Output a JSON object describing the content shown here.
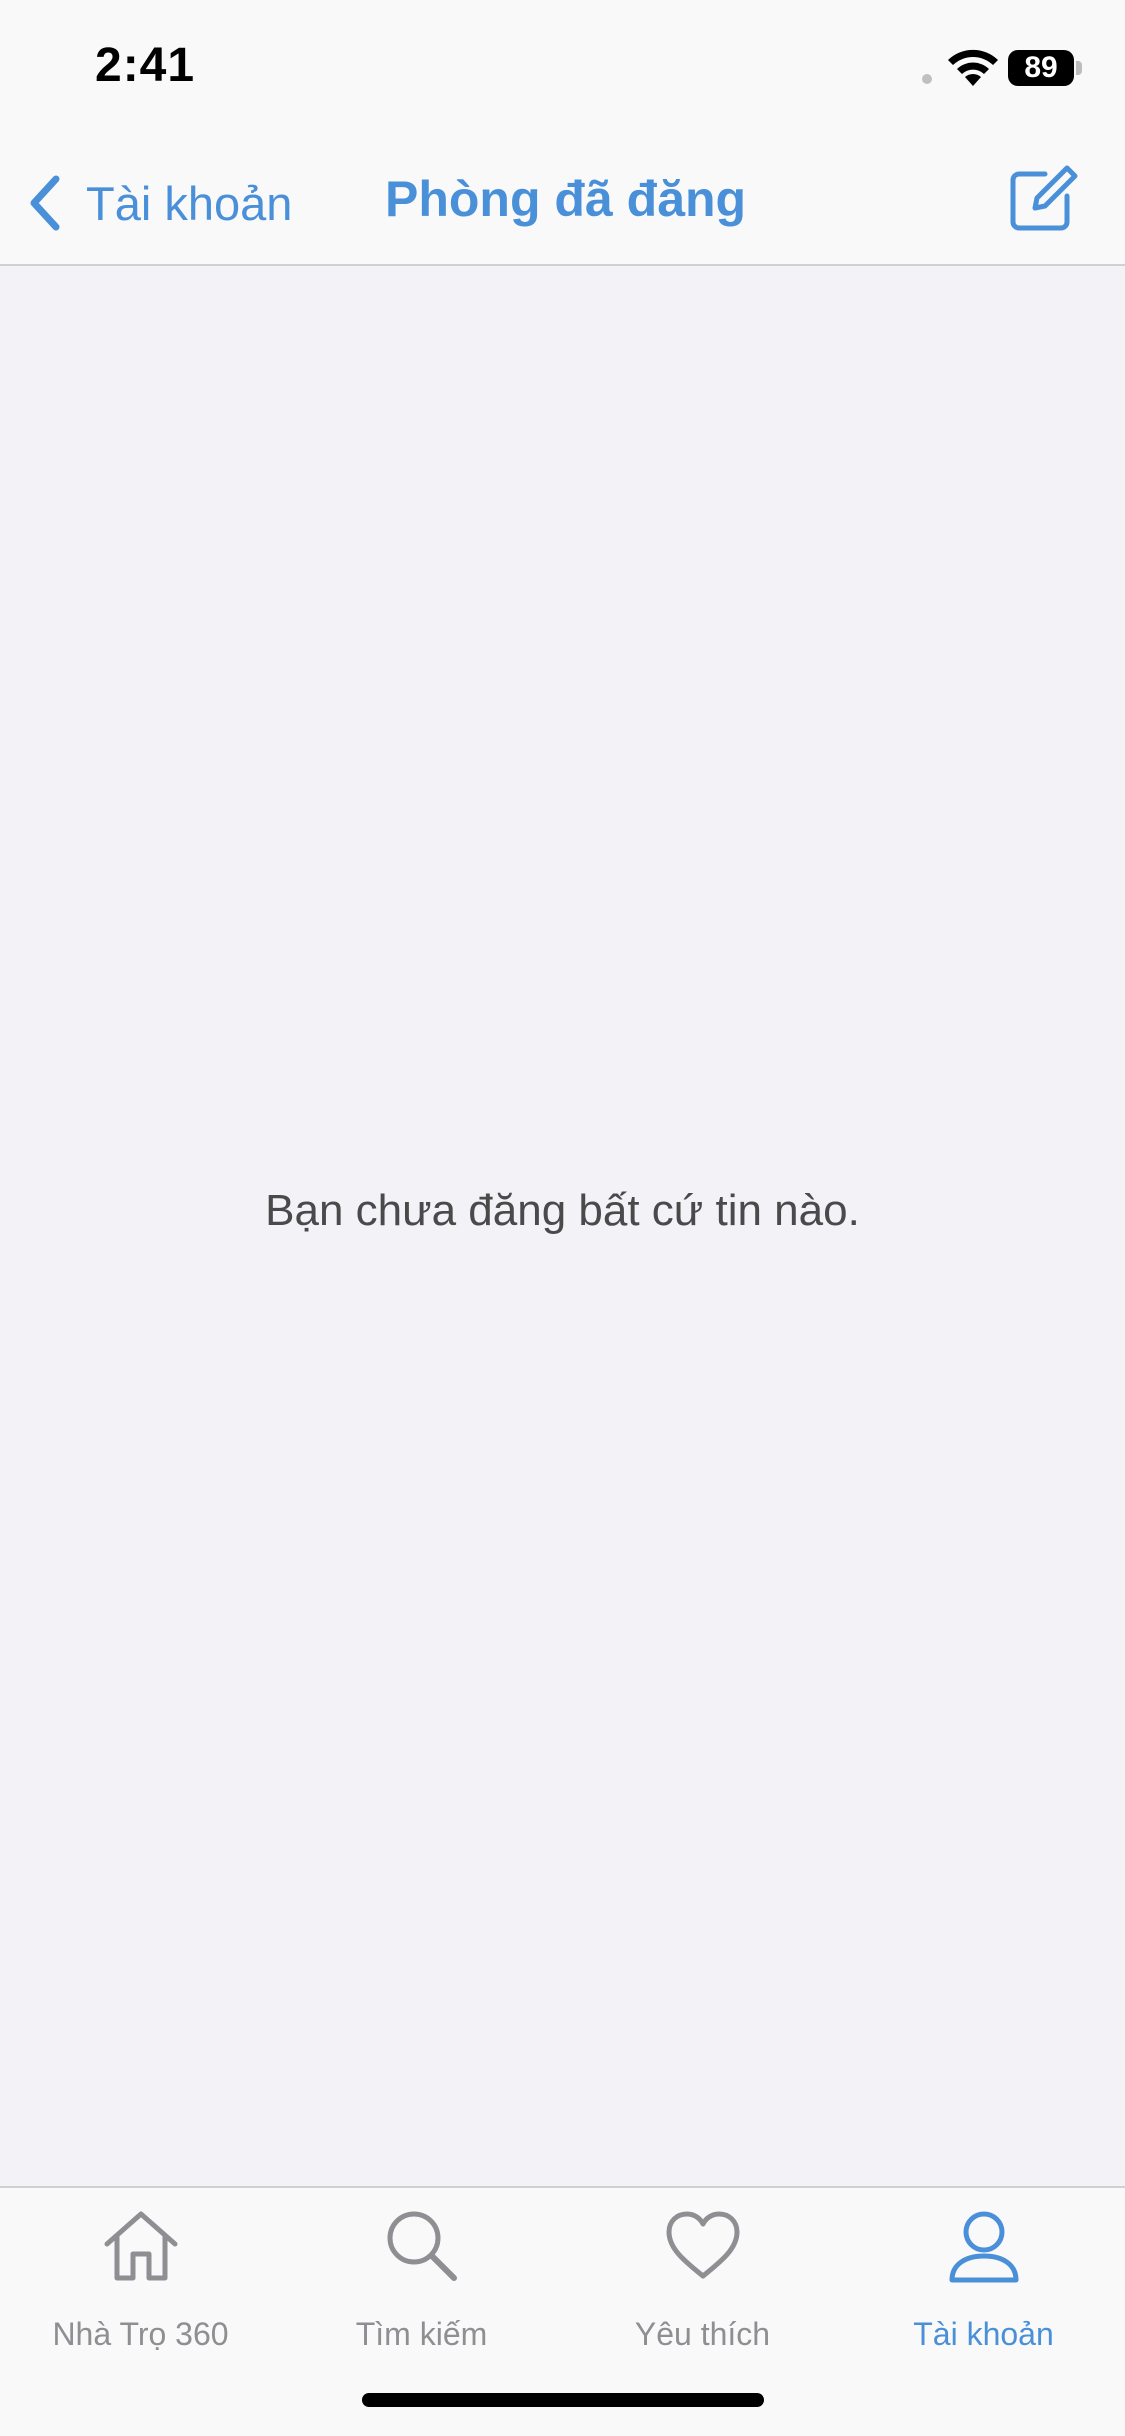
{
  "status_bar": {
    "time": "2:41",
    "battery": "89"
  },
  "nav": {
    "back_label": "Tài khoản",
    "title": "Phòng đã đăng",
    "back_icon": "chevron-left-icon",
    "compose_icon": "compose-icon"
  },
  "content": {
    "empty_message": "Bạn chưa đăng bất cứ tin nào."
  },
  "tabs": [
    {
      "label": "Nhà Trọ 360",
      "icon": "home-icon",
      "active": false
    },
    {
      "label": "Tìm kiếm",
      "icon": "search-icon",
      "active": false
    },
    {
      "label": "Yêu thích",
      "icon": "heart-icon",
      "active": false
    },
    {
      "label": "Tài khoản",
      "icon": "person-icon",
      "active": true
    }
  ],
  "colors": {
    "accent": "#4a90d9",
    "inactive": "#8e8e93",
    "background": "#f2f2f7",
    "bar": "#f9f9f9"
  }
}
